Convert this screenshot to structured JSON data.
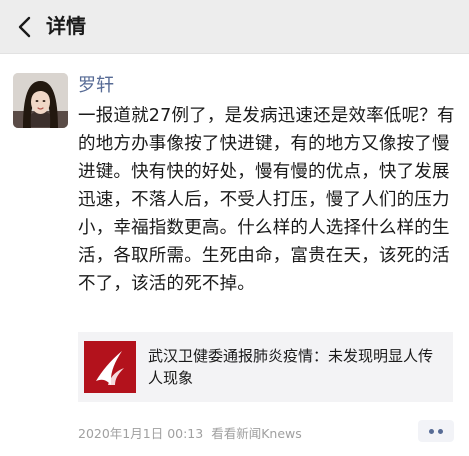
{
  "header": {
    "title": "详情",
    "back_icon": "back-arrow-icon"
  },
  "post": {
    "author": "罗轩",
    "avatar_icon": "user-avatar",
    "text": "一报道就27例了，是发病迅速还是效率低呢？有的地方办事像按了快进键，有的地方又像按了慢进键。快有快的好处，慢有慢的优点，快了发展迅速，不落人后，不受人打压，慢了人们的压力小，幸福指数更高。什么样的人选择什么样的生活，各取所需。生死由命，富贵在天，该死的活不了，该活的死不掉。",
    "link": {
      "title": "武汉卫健委通报肺炎疫情：未发现明显人传人现象",
      "thumb_icon": "red-swoosh-logo"
    },
    "meta": {
      "timestamp": "2020年1月1日 00:13",
      "source": "看看新闻Knews"
    },
    "more_icon": "more-dots-icon"
  },
  "colors": {
    "header_bg": "#ededed",
    "author_link": "#576b95",
    "text": "#1a1a1a",
    "meta": "#a0a0a0",
    "card_bg": "#f3f3f5",
    "thumb_red": "#b3121c"
  }
}
